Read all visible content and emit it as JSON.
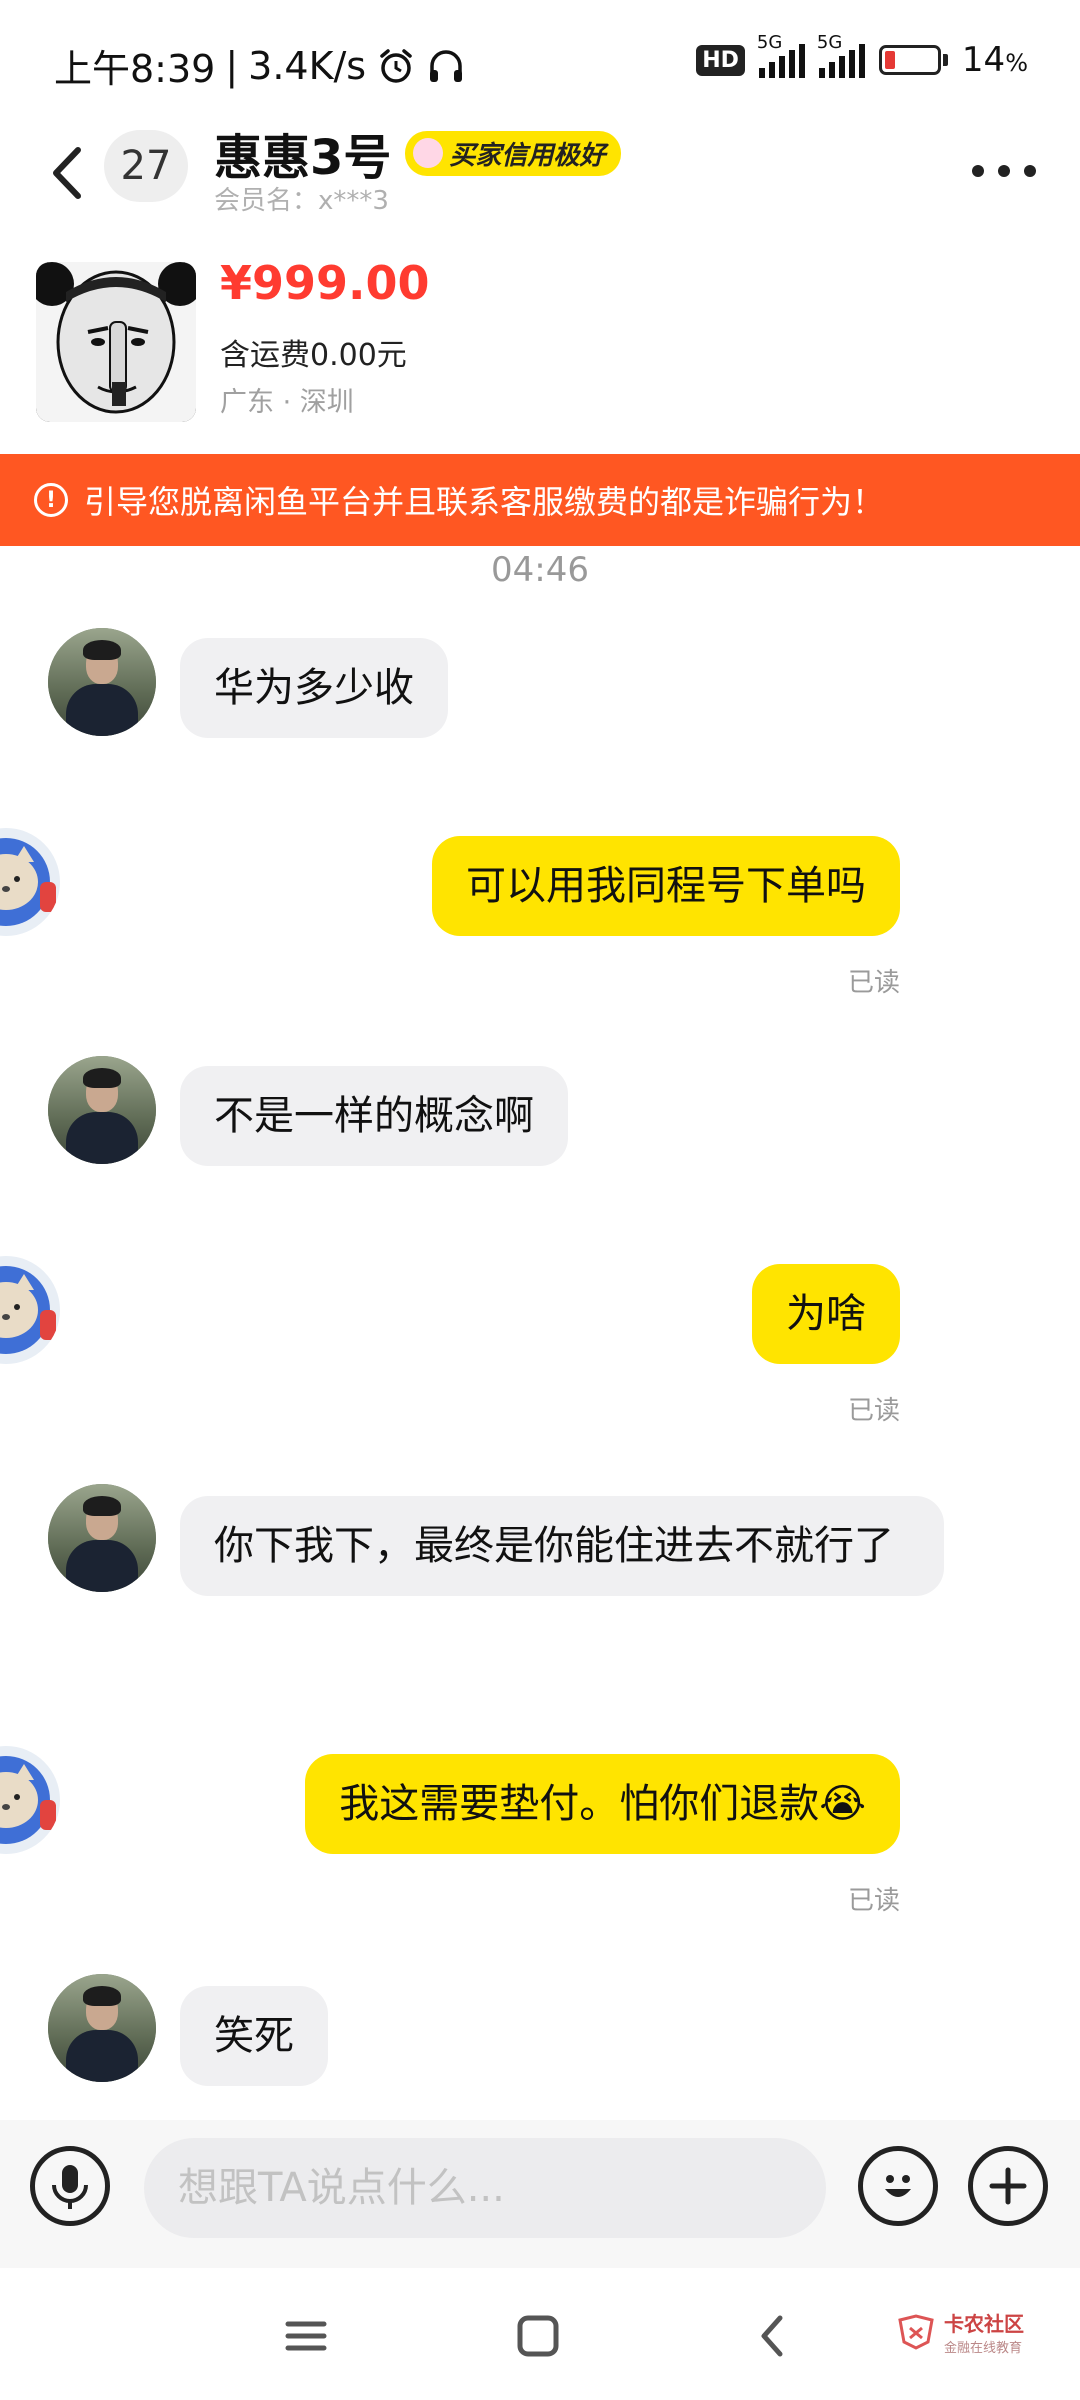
{
  "status_bar": {
    "time": "上午8:39",
    "speed": "3.4K/s",
    "hd_label": "HD",
    "sim1_label": "5G",
    "sim2_label": "5G",
    "battery_percent": "14",
    "battery_unit": "%",
    "battery_color": "#e53935"
  },
  "header": {
    "unread_count": "27",
    "title": "惠惠3号",
    "credit_tag": "买家信用极好",
    "member_name": "会员名：x***3"
  },
  "product": {
    "price": "¥999.00",
    "shipping": "含运费0.00元",
    "location": "广东 · 深圳"
  },
  "warning": {
    "icon": "!",
    "text": "引导您脱离闲鱼平台并且联系客服缴费的都是诈骗行为！",
    "color": "#ff5722"
  },
  "chat": {
    "time_divider": "04:46",
    "messages": [
      {
        "side": "left",
        "text": "华为多少收"
      },
      {
        "side": "right",
        "text": "可以用我同程号下单吗",
        "status": "已读"
      },
      {
        "side": "left",
        "text": "不是一样的概念啊"
      },
      {
        "side": "right",
        "text": "为啥",
        "status": "已读"
      },
      {
        "side": "left",
        "text": "你下我下，最终是你能住进去不就行了"
      },
      {
        "side": "right",
        "text": "我这需要垫付。怕你们退款😭",
        "status": "已读"
      },
      {
        "side": "left",
        "text": "笑死"
      }
    ],
    "bubble_colors": {
      "sent": "#ffe400",
      "received": "#f0f0f2"
    }
  },
  "input": {
    "placeholder": "想跟TA说点什么..."
  },
  "watermark": {
    "title": "卡农社区",
    "subtitle": "金融在线教育"
  }
}
